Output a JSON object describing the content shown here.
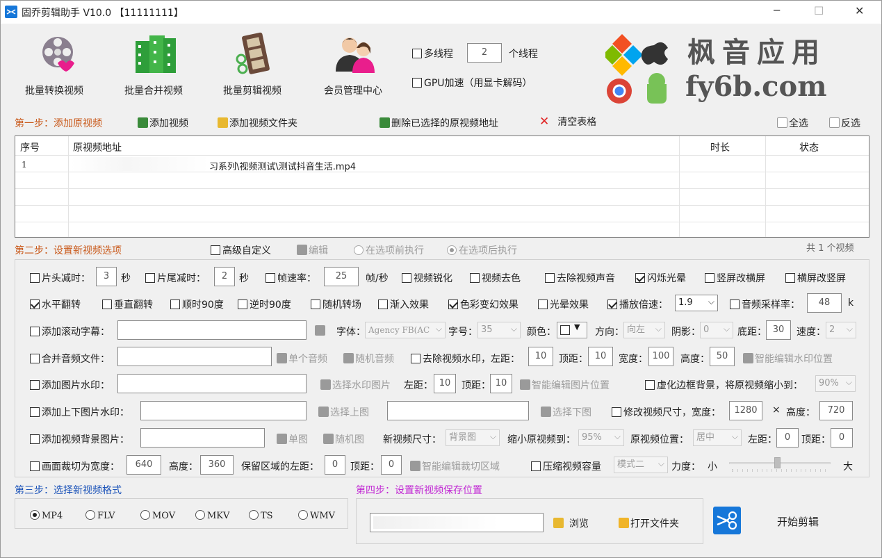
{
  "window": {
    "title": "固乔剪辑助手 V10.0 【11111111】",
    "minimize": "─",
    "maximize": "☐",
    "close": "✕"
  },
  "toolbar": {
    "buttons": [
      {
        "label": "批量转换视频",
        "icon": "film-reel-icon"
      },
      {
        "label": "批量合并视频",
        "icon": "film-strip-merge-icon"
      },
      {
        "label": "批量剪辑视频",
        "icon": "film-scissors-icon"
      },
      {
        "label": "会员管理中心",
        "icon": "users-icon"
      }
    ],
    "multithread_label": "多线程",
    "thread_count": "2",
    "thread_unit": "个线程",
    "gpu_label": "GPU加速（用显卡解码）"
  },
  "watermark": {
    "line1": "枫音应用",
    "line2": "fy6b.com"
  },
  "step1": {
    "title": "第一步：添加原视频",
    "add_video": "添加视频",
    "add_folder": "添加视频文件夹",
    "delete_selected": "删除已选择的原视频地址",
    "clear_table": "清空表格",
    "select_all": "全选",
    "invert": "反选"
  },
  "table": {
    "headers": [
      "序号",
      "原视频地址",
      "时长",
      "状态"
    ],
    "rows": [
      {
        "index": "1",
        "path": "习系列\\视频测试\\测试抖音生活.mp4",
        "duration": "",
        "status": ""
      }
    ]
  },
  "step2": {
    "title": "第二步：设置新视频选项",
    "advanced": "高级自定义",
    "edit": "编辑",
    "before": "在选项前执行",
    "after": "在选项后执行",
    "count": "共 1 个视频"
  },
  "options": {
    "head_cut": "片头减时：",
    "head_val": "3",
    "sec1": "秒",
    "tail_cut": "片尾减时：",
    "tail_val": "2",
    "sec2": "秒",
    "fps": "帧速率：",
    "fps_val": "25",
    "fps_unit": "帧/秒",
    "sharpen": "视频锐化",
    "decolor": "视频去色",
    "mute": "去除视频声音",
    "flash": "闪烁光晕",
    "v2h": "竖屏改横屏",
    "h2v": "横屏改竖屏",
    "hflip": "水平翻转",
    "vflip": "垂直翻转",
    "cw90": "顺时90度",
    "ccw90": "逆时90度",
    "random_trans": "随机转场",
    "fade": "渐入效果",
    "color_shift": "色彩变幻效果",
    "halo": "光晕效果",
    "speed": "播放倍速：",
    "speed_val": "1.9",
    "sample_rate": "音频采样率：",
    "sample_val": "48",
    "sample_unit": "k",
    "subtitle": "添加滚动字幕：",
    "font": "字体：",
    "font_val": "Agency FB(AC",
    "fontsize": "字号：",
    "fontsize_val": "35",
    "color": "颜色：",
    "direction": "方向：",
    "direction_val": "向左",
    "shadow": "阴影：",
    "shadow_val": "0",
    "bottom": "底距：",
    "bottom_val": "30",
    "speed2": "速度：",
    "speed2_val": "2",
    "merge_audio": "合并音频文件：",
    "single_audio": "单个音频",
    "random_audio": "随机音频",
    "remove_wm": "去除视频水印，左距：",
    "wm_left": "10",
    "top": "顶距：",
    "wm_top": "10",
    "width": "宽度：",
    "wm_width": "100",
    "height": "高度：",
    "wm_height": "50",
    "smart_wm": "智能编辑水印位置",
    "img_wm": "添加图片水印：",
    "choose_wm_img": "选择水印图片",
    "left": "左距：",
    "imgwm_left": "10",
    "imgwm_top": "10",
    "smart_img": "智能编辑图片位置",
    "blur_bg": "虚化边框背景，将原视频缩小到：",
    "blur_val": "90%",
    "topbottom_wm": "添加上下图片水印：",
    "choose_top": "选择上图",
    "choose_bottom": "选择下图",
    "resize": "修改视频尺寸，宽度：",
    "resize_w": "1280",
    "times": "×",
    "resize_h_label": "高度：",
    "resize_h": "720",
    "bg_img": "添加视频背景图片：",
    "single_img": "单图",
    "random_img": "随机图",
    "new_size": "新视频尺寸：",
    "new_size_val": "背景图",
    "shrink": "缩小原视频到：",
    "shrink_val": "95%",
    "orig_pos": "原视频位置：",
    "orig_pos_val": "居中",
    "bg_left": "0",
    "bg_top": "0",
    "crop": "画面裁切为宽度：",
    "crop_w": "640",
    "crop_h_label": "高度：",
    "crop_h": "360",
    "keep_left": "保留区域的左距：",
    "keep_left_val": "0",
    "keep_top_val": "0",
    "smart_crop": "智能编辑裁切区域",
    "compress": "压缩视频容量",
    "compress_mode": "模式二",
    "strength": "力度：",
    "small": "小",
    "big": "大"
  },
  "step3": {
    "title": "第三步：选择新视频格式",
    "formats": [
      "MP4",
      "FLV",
      "MOV",
      "MKV",
      "TS",
      "WMV"
    ],
    "selected": "MP4"
  },
  "step4": {
    "title": "第四步：设置新视频保存位置",
    "browse": "浏览",
    "open_folder": "打开文件夹",
    "start": "开始剪辑"
  },
  "colors": {
    "accent": "#1a52b8",
    "orange": "#c9591a",
    "magenta": "#c026d3",
    "start_icon": "#1677d9"
  }
}
